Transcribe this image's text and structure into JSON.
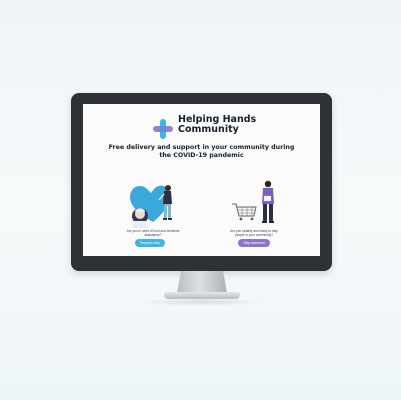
{
  "brand": {
    "name_line1": "Helping Hands",
    "name_line2": "Community"
  },
  "hero": {
    "headline_line1": "Free delivery and support in your community during",
    "headline_line2": "the COVID-19 pandemic"
  },
  "cards": [
    {
      "question_line1": "Are you in need of food and medicine",
      "question_line2": "assistance?",
      "button_label": "Request help"
    },
    {
      "question_line1": "Are you healthy and ready to help",
      "question_line2": "people in your community?",
      "button_label": "Help someone"
    }
  ],
  "colors": {
    "monitor_bezel": "#2e3236",
    "request_button": "#3cb4e6",
    "help_button": "#8b74c9",
    "logo_blue": "#3cb4e6",
    "logo_purple": "#8b74c9"
  },
  "icons": [
    "helping-hands-logo-icon",
    "person-with-heart-illustration",
    "shopper-with-cart-illustration"
  ]
}
